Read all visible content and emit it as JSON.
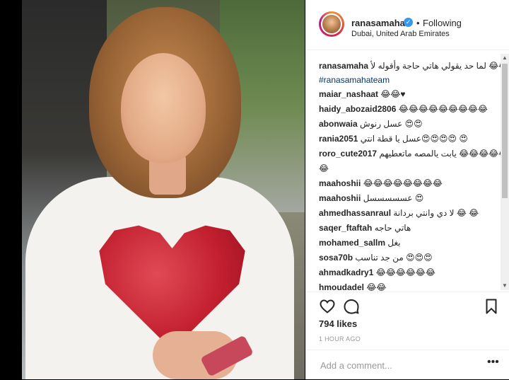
{
  "post": {
    "username": "ranasamaha",
    "separator": "•",
    "follow_status": "Following",
    "location": "Dubai, United Arab Emirates",
    "caption": {
      "user": "ranasamaha",
      "text": "لما حد يقولي هاتي حاجة وأقوله لأ 😂😂",
      "hashtag": "#ranasamahateam"
    },
    "comments": [
      {
        "user": "maiar_nashaat",
        "text": "😂😂♥"
      },
      {
        "user": "haidy_abozaid2806",
        "text": "😂😂😂😂😂😂😂😂😂"
      },
      {
        "user": "abonwaia",
        "text": "عسل رنوش 😍😍"
      },
      {
        "user": "rania2051",
        "text": "عسل يا قطة انتي😍😍😍😍 😍"
      },
      {
        "user": "roro_cute2017",
        "text": "يابت يالمصه ماتعطيهم 😂😂😂😂😂"
      },
      {
        "user": "",
        "text": "😂"
      },
      {
        "user": "maahoshii",
        "text": "😂😂😂😂😂😂😂😂"
      },
      {
        "user": "maahoshii",
        "text": "عسسسسسل 😍"
      },
      {
        "user": "ahmedhassanraul",
        "text": "لا دي وانتي بردانة 😂 😂"
      },
      {
        "user": "saqer_ftaftah",
        "text": "هاتي حاجه"
      },
      {
        "user": "mohamed_sallm",
        "text": "بغل"
      },
      {
        "user": "sosa70b",
        "text": "من جد تناسب 😍😍😍"
      },
      {
        "user": "ahmadkadry1",
        "text": "😂😂😂😂😂😂"
      },
      {
        "user": "hmoudadel",
        "text": "😂😂"
      }
    ],
    "likes": "794 likes",
    "time": "1 HOUR AGO",
    "comment_placeholder": "Add a comment...",
    "more_label": "•••"
  },
  "icons": {
    "verified": "verified-badge-icon",
    "like": "heart-icon",
    "comment": "comment-bubble-icon",
    "save": "bookmark-icon"
  },
  "colors": {
    "verified_blue": "#3897f0",
    "hashtag": "#003569",
    "text": "#262626",
    "muted": "#999999"
  }
}
